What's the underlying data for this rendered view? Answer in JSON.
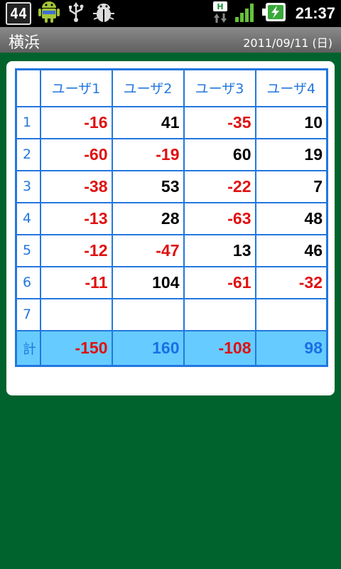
{
  "status_bar": {
    "notification_count": "44",
    "network_letter": "H",
    "time": "21:37"
  },
  "titlebar": {
    "title": "横浜",
    "date": "2011/09/11 (日)"
  },
  "table": {
    "headers": [
      "ユーザ1",
      "ユーザ2",
      "ユーザ3",
      "ユーザ4"
    ],
    "rows": [
      {
        "label": "1",
        "values": [
          "-16",
          "41",
          "-35",
          "10"
        ]
      },
      {
        "label": "2",
        "values": [
          "-60",
          "-19",
          "60",
          "19"
        ]
      },
      {
        "label": "3",
        "values": [
          "-38",
          "53",
          "-22",
          "7"
        ]
      },
      {
        "label": "4",
        "values": [
          "-13",
          "28",
          "-63",
          "48"
        ]
      },
      {
        "label": "5",
        "values": [
          "-12",
          "-47",
          "13",
          "46"
        ]
      },
      {
        "label": "6",
        "values": [
          "-11",
          "104",
          "-61",
          "-32"
        ]
      },
      {
        "label": "7",
        "values": [
          "",
          "",
          "",
          ""
        ]
      }
    ],
    "total": {
      "label": "計",
      "values": [
        "-150",
        "160",
        "-108",
        "98"
      ]
    }
  },
  "colors": {
    "background": "#00632e",
    "grid": "#2277dd",
    "negative": "#e01010",
    "total_row": "#66ccff"
  }
}
